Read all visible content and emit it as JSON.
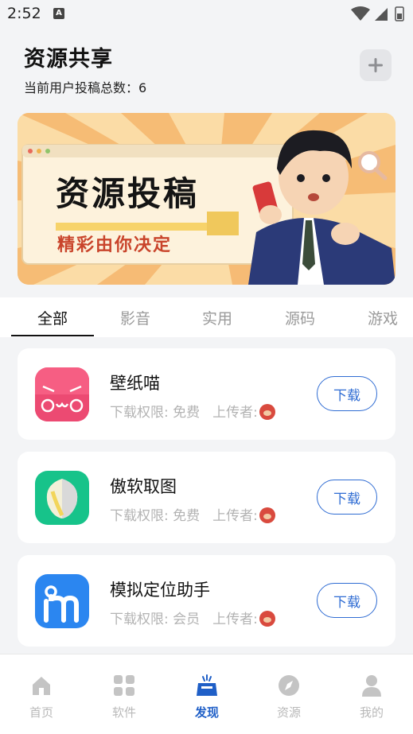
{
  "status_bar": {
    "time": "2:52",
    "notification_icon": "A"
  },
  "header": {
    "title": "资源共享",
    "count_label": "当前用户投稿总数：",
    "count_value": "6",
    "add_icon": "plus-icon"
  },
  "banner": {
    "title": "资源投稿",
    "subtitle": "精彩由你决定"
  },
  "tabs": [
    {
      "label": "全部",
      "active": true
    },
    {
      "label": "影音",
      "active": false
    },
    {
      "label": "实用",
      "active": false
    },
    {
      "label": "源码",
      "active": false
    },
    {
      "label": "游戏",
      "active": false
    }
  ],
  "apps": [
    {
      "name": "壁纸喵",
      "permission": "下载权限: 免费",
      "uploader_label": "上传者:",
      "button": "下载",
      "icon": "cat-face-icon",
      "icon_color": "#f2577a"
    },
    {
      "name": "傲软取图",
      "permission": "下载权限: 免费",
      "uploader_label": "上传者:",
      "button": "下载",
      "icon": "leaf-icon",
      "icon_color": "#19c48b"
    },
    {
      "name": "模拟定位助手",
      "permission": "下载权限: 会员",
      "uploader_label": "上传者:",
      "button": "下载",
      "icon": "letter-m-icon",
      "icon_color": "#2b86f0"
    }
  ],
  "bottom_nav": [
    {
      "label": "首页",
      "icon": "home-icon",
      "active": false
    },
    {
      "label": "软件",
      "icon": "grid-icon",
      "active": false
    },
    {
      "label": "发现",
      "icon": "inbox-icon",
      "active": true
    },
    {
      "label": "资源",
      "icon": "compass-icon",
      "active": false
    },
    {
      "label": "我的",
      "icon": "user-icon",
      "active": false
    }
  ],
  "colors": {
    "accent": "#1f5fc7",
    "button": "#2f6cd3",
    "banner_red": "#c9442b"
  }
}
